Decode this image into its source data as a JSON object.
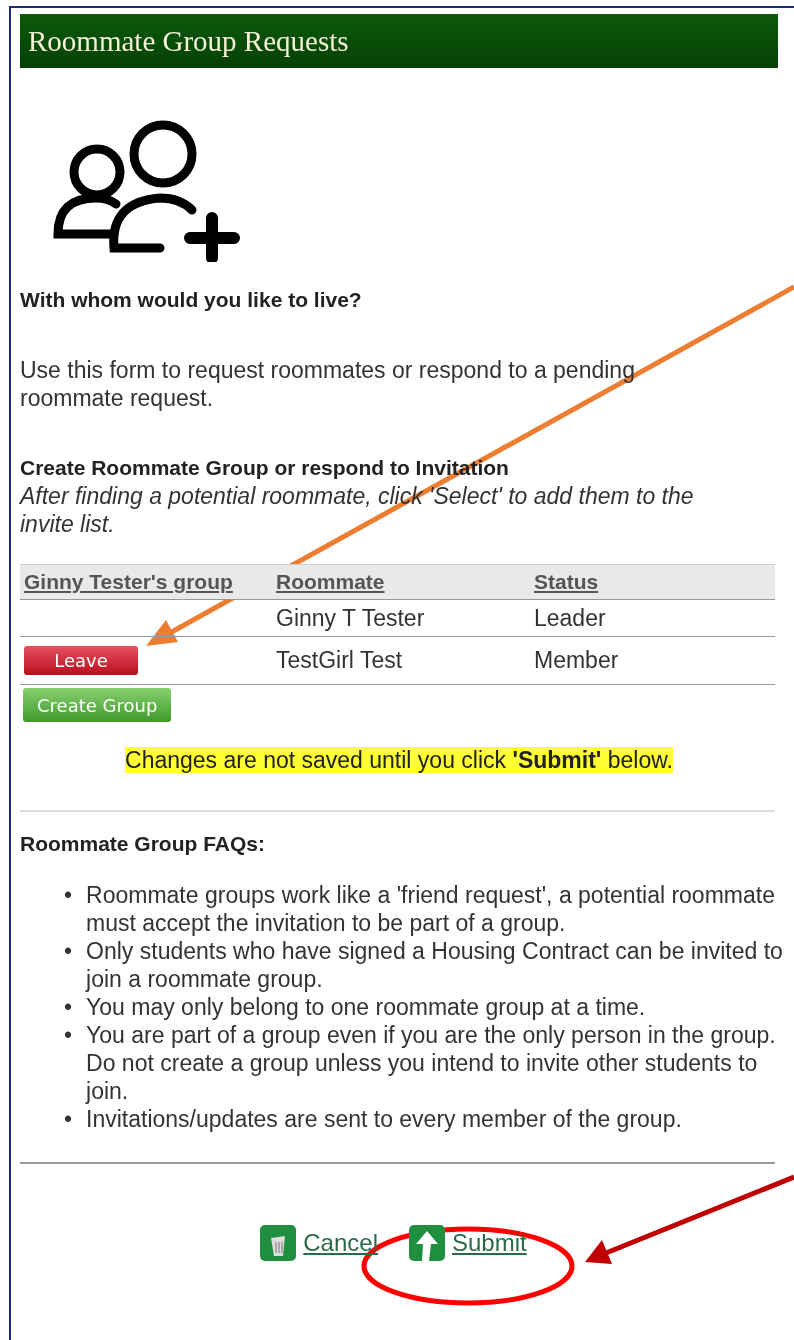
{
  "header": {
    "title": "Roommate Group Requests"
  },
  "question": "With whom would you like to live?",
  "intro": "Use this form to request roommates or respond to a pending roommate request.",
  "create_section": {
    "title": "Create Roommate Group or respond to Invitation",
    "hint": "After finding a potential roommate, click 'Select' to add them to the invite list."
  },
  "table": {
    "columns": [
      "Ginny Tester's group",
      "Roommate",
      "Status"
    ],
    "rows": [
      {
        "roommate": "Ginny T Tester",
        "status": "Leader"
      },
      {
        "action": {
          "label": "Leave",
          "kind": "danger"
        },
        "roommate": "TestGirl Test",
        "status": "Member"
      }
    ]
  },
  "create_button": {
    "label": "Create Group",
    "kind": "success"
  },
  "notice": "Changes are not saved until you click **'Submit'** below.",
  "faq": {
    "title": "Roommate Group FAQs:",
    "items": [
      {
        "bullet": "•",
        "text": "Roommate groups work like a 'friend request', a potential roommate must accept the invitation to be part of a group."
      },
      {
        "bullet": "•",
        "text": "Only students who have signed a  Housing Contract can be invited to join a roommate group."
      },
      {
        "bullet": "•",
        "text": "You may only belong to one roommate group at a time."
      },
      {
        "bullet": "•",
        "text": "You are part of a group even if you are the only person in the group. Do not create a group unless you intend to invite other students to join."
      },
      {
        "bullet": "•",
        "text": "Invitations/updates are sent to every member of the group."
      }
    ]
  },
  "links": [
    {
      "label": "Cancel",
      "kind": "cancel"
    },
    {
      "label": "Submit",
      "kind": "submit"
    }
  ]
}
